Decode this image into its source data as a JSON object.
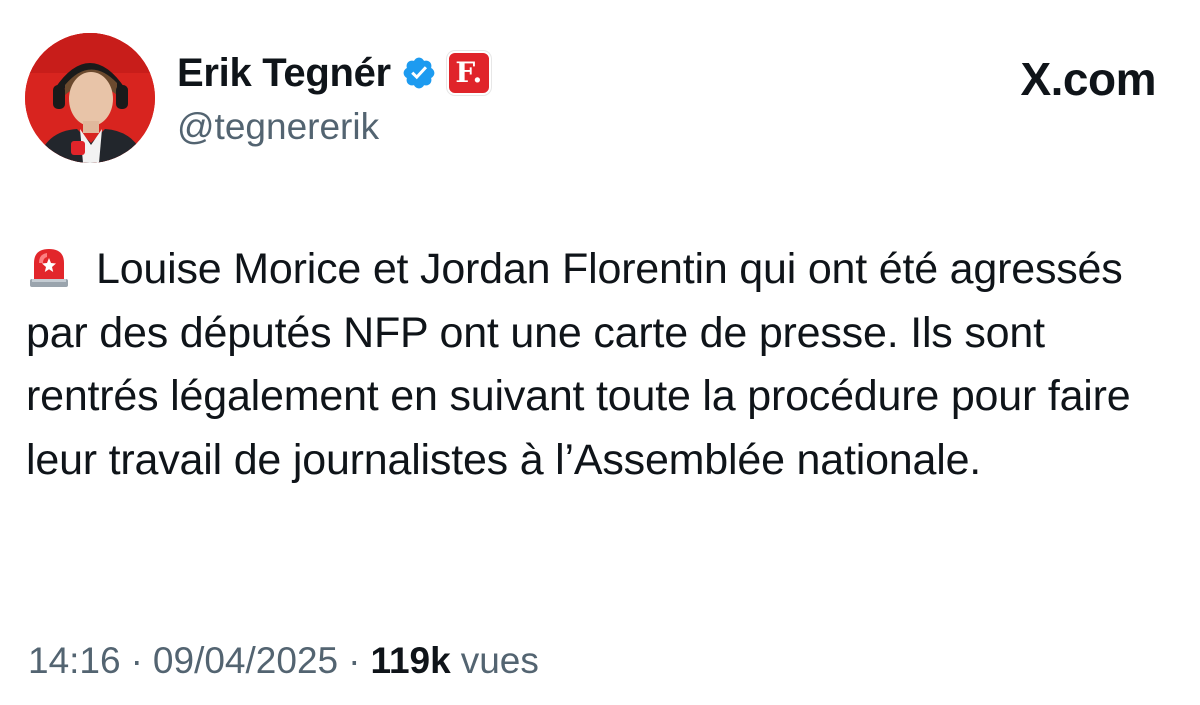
{
  "author": {
    "display_name": "Erik Tegnér",
    "handle": "@tegnererik",
    "verified_icon": "verified-badge-icon",
    "affiliate_badge": "F."
  },
  "brand": {
    "text": "X.com"
  },
  "tweet": {
    "emoji_icon": "rotating-light-icon",
    "text": "Louise Morice et Jordan Florentin qui ont été agressés par des députés NFP ont une carte de presse. Ils sont rentrés légalement en suivant toute la procédure pour faire leur travail de journalistes à l’Assemblée nationale."
  },
  "meta": {
    "time": "14:16",
    "separator": "·",
    "date": "09/04/2025",
    "views_count": "119k",
    "views_label": "vues"
  },
  "colors": {
    "text_primary": "#0f1419",
    "text_secondary": "#536471",
    "verified_blue": "#1d9bf0",
    "affiliate_red": "#e0242a"
  }
}
